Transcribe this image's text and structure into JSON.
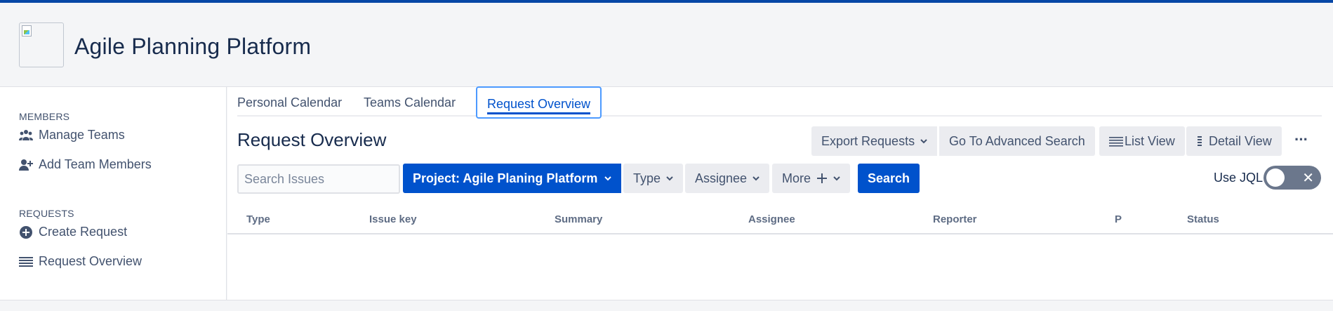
{
  "app": {
    "title": "Agile Planning Platform"
  },
  "sidebar": {
    "members_title": "MEMBERS",
    "manage_teams": "Manage Teams",
    "add_team_members": "Add Team Members",
    "requests_title": "REQUESTS",
    "create_request": "Create Request",
    "request_overview": "Request Overview"
  },
  "tabs": [
    {
      "label": "Personal Calendar"
    },
    {
      "label": "Teams Calendar"
    },
    {
      "label": "Request Overview",
      "active": true
    }
  ],
  "page": {
    "title": "Request Overview"
  },
  "toolbar": {
    "export_requests": "Export Requests",
    "go_advanced_search": "Go To Advanced Search",
    "list_view": "List View",
    "detail_view": "Detail View",
    "more_menu": "···"
  },
  "filters": {
    "search_placeholder": "Search Issues",
    "project": "Project: Agile Planing Platform",
    "type": "Type",
    "assignee": "Assignee",
    "more": "More",
    "search_button": "Search",
    "use_jql_label": "Use JQL",
    "use_jql_enabled": false
  },
  "table": {
    "columns": [
      "Type",
      "Issue key",
      "Summary",
      "Assignee",
      "Reporter",
      "P",
      "Status"
    ]
  },
  "colors": {
    "accent": "#0052cc",
    "top_bar": "#0747a6",
    "toggle_off": "#6b778c"
  }
}
